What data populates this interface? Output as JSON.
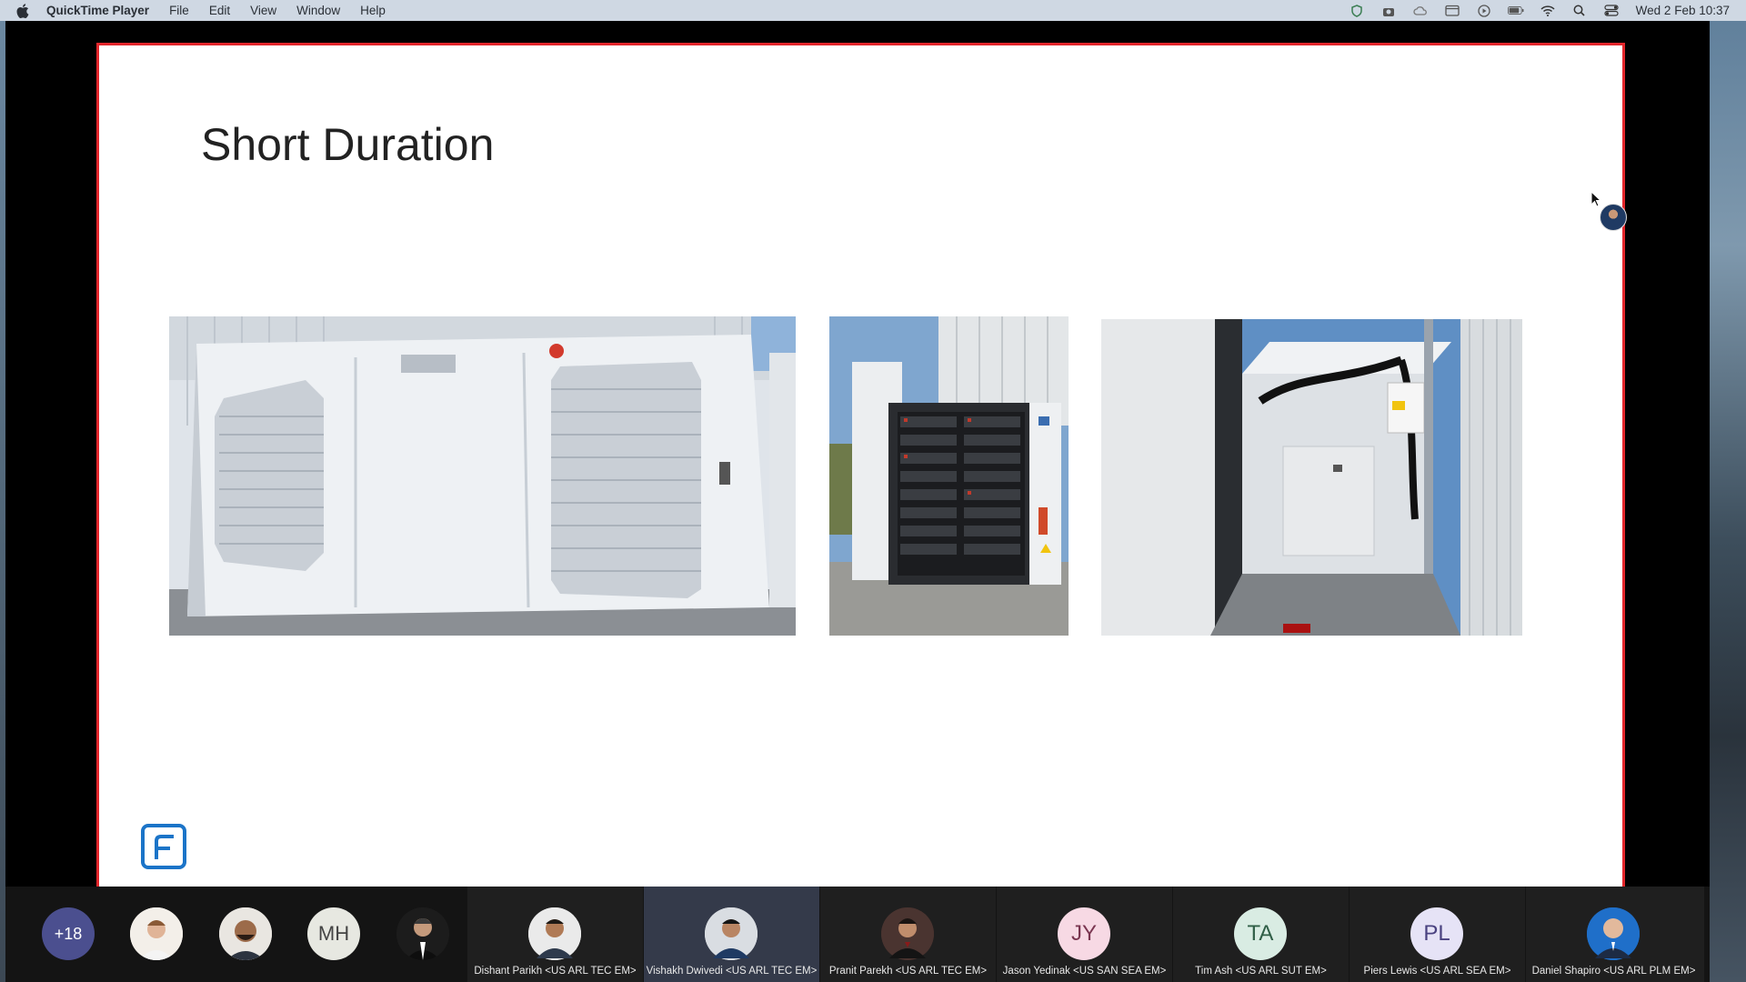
{
  "menubar": {
    "app_name": "QuickTime Player",
    "items": [
      "File",
      "Edit",
      "View",
      "Window",
      "Help"
    ],
    "clock": "Wed 2 Feb  10:37"
  },
  "slide": {
    "title": "Short Duration"
  },
  "participants": {
    "overflow_count": "+18",
    "initials_small": "MH",
    "tiles": [
      {
        "name": "Dishant Parikh <US ARL TEC EM>",
        "initials": ""
      },
      {
        "name": "Vishakh Dwivedi <US ARL TEC EM>",
        "initials": ""
      },
      {
        "name": "Pranit Parekh  <US ARL TEC EM>",
        "initials": ""
      },
      {
        "name": "Jason Yedinak <US SAN SEA EM>",
        "initials": "JY"
      },
      {
        "name": "Tim Ash <US ARL SUT EM>",
        "initials": "TA"
      },
      {
        "name": "Piers Lewis <US ARL SEA EM>",
        "initials": "PL"
      },
      {
        "name": "Daniel Shapiro <US ARL PLM EM>",
        "initials": ""
      }
    ]
  },
  "colors": {
    "slide_border": "#e3262b",
    "logo_blue": "#1b74c8",
    "overflow_badge": "#4b4f8f",
    "jy_bg": "#f7d9e4",
    "ta_bg": "#d9ece3",
    "pl_bg": "#e6e3f6"
  }
}
